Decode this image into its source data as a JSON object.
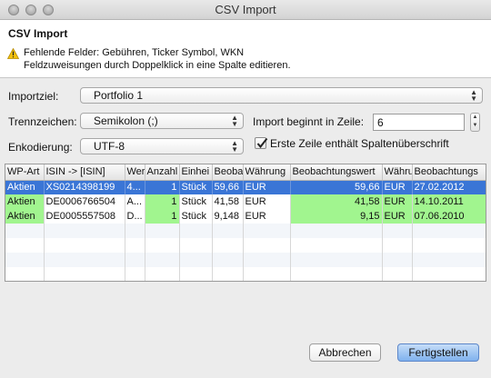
{
  "window": {
    "title": "CSV Import"
  },
  "header": {
    "title": "CSV Import",
    "message_line1": "Fehlende Felder: Gebühren, Ticker Symbol, WKN",
    "message_line2": "Feldzuweisungen durch Doppelklick in eine Spalte editieren."
  },
  "form": {
    "importziel_label": "Importziel:",
    "importziel_value": "Portfolio 1",
    "trennzeichen_label": "Trennzeichen:",
    "trennzeichen_value": "Semikolon (;)",
    "enkodierung_label": "Enkodierung:",
    "enkodierung_value": "UTF-8",
    "import_start_label": "Import beginnt in Zeile:",
    "import_start_value": "6",
    "header_row_label": "Erste Zeile enthält Spaltenüberschrift",
    "header_row_checked": true
  },
  "table": {
    "columns": [
      "WP-Art",
      "ISIN -> [ISIN]",
      "Wer",
      "Anzahl",
      "Einhei",
      "Beoba",
      "Währung",
      "Beobachtungswert",
      "Währu",
      "Beobachtungs"
    ],
    "rows": [
      [
        "Aktien",
        "XS0214398199",
        "4...",
        "1",
        "Stück",
        "59,66",
        "EUR",
        "59,66",
        "EUR",
        "27.02.2012"
      ],
      [
        "Aktien",
        "DE0006766504",
        "A...",
        "1",
        "Stück",
        "41,58",
        "EUR",
        "41,58",
        "EUR",
        "14.10.2011"
      ],
      [
        "Aktien",
        "DE0005557508",
        "D...",
        "1",
        "Stück",
        "9,148",
        "EUR",
        "9,15",
        "EUR",
        "07.06.2010"
      ]
    ]
  },
  "buttons": {
    "cancel": "Abbrechen",
    "finish": "Fertigstellen"
  },
  "colors": {
    "selection": "#3a75d6",
    "missing_field_highlight": "#a1f58f"
  }
}
